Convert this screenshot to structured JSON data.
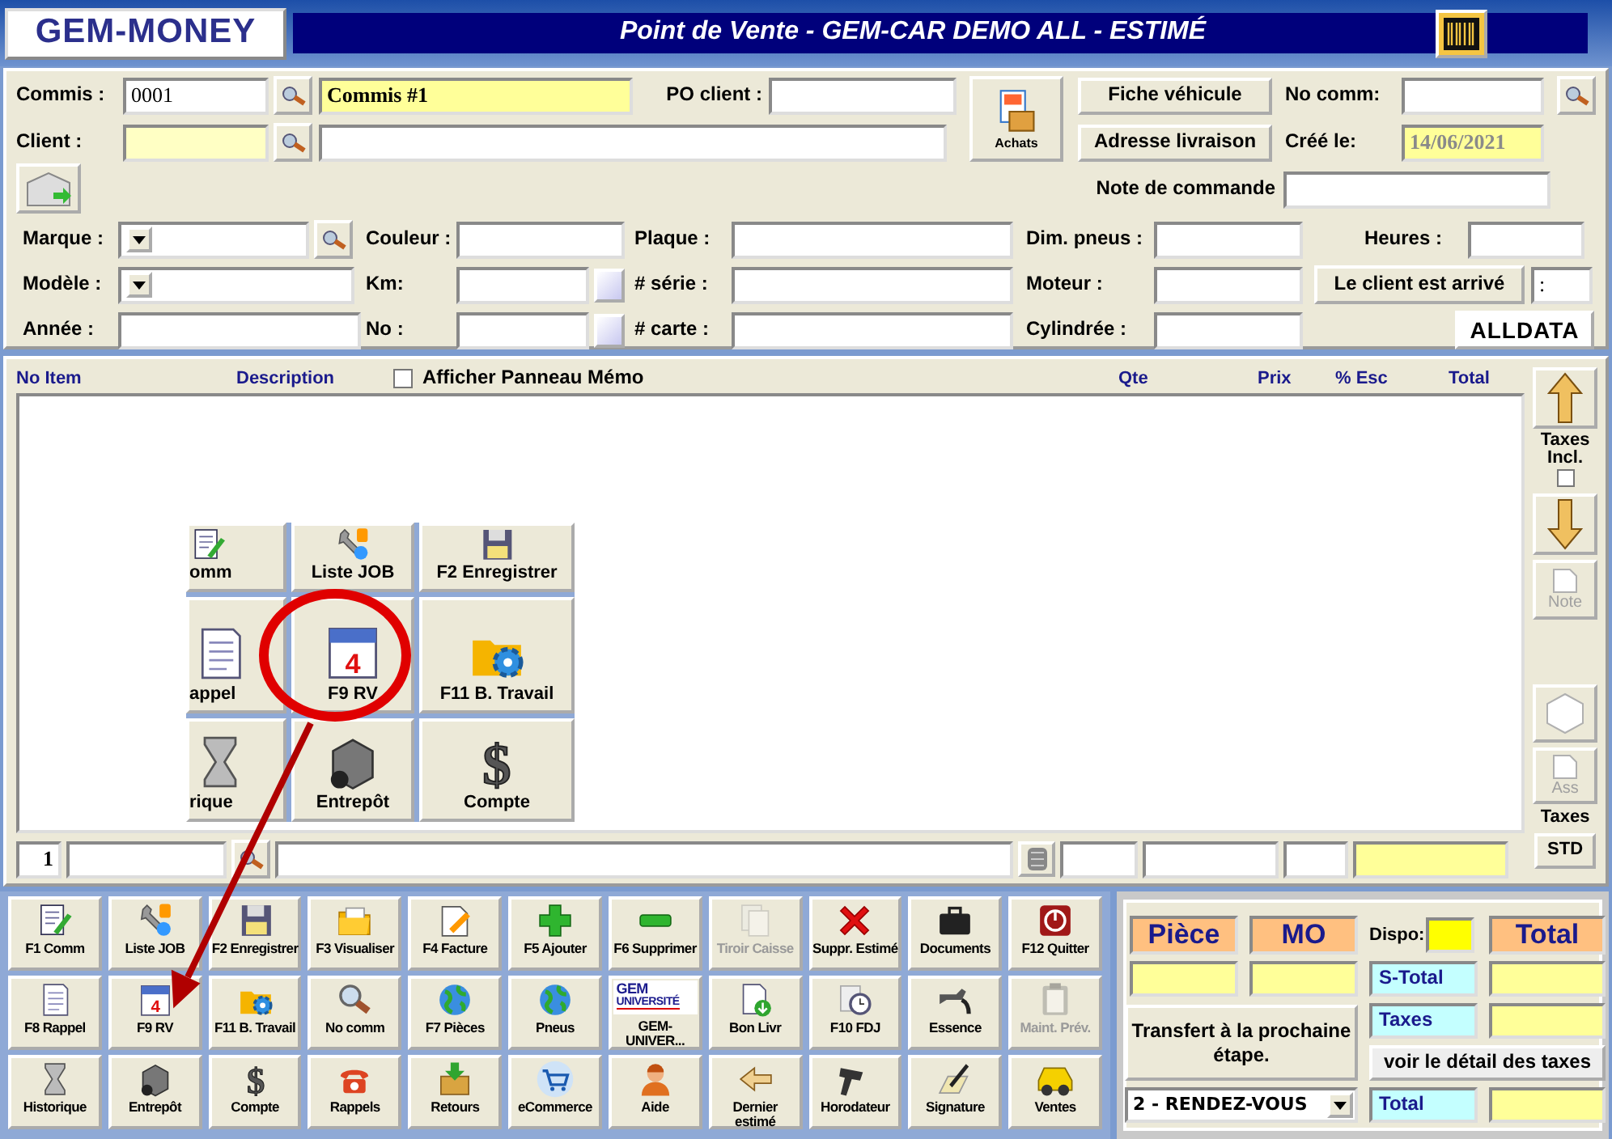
{
  "window": {
    "logo": "GEM-MONEY",
    "title": "Point de Vente - GEM-CAR DEMO ALL  - ESTIMÉ"
  },
  "order": {
    "commis_label": "Commis :",
    "commis_value": "0001",
    "commis_name": "Commis #1",
    "client_label": "Client :",
    "po_label": "PO client :",
    "achats": "Achats",
    "fiche_button": "Fiche véhicule",
    "adresse_button": "Adresse livraison",
    "no_comm_label": "No comm:",
    "cree_label": "Créé le:",
    "cree_value": "14/06/2021",
    "note_label": "Note de commande"
  },
  "vehicle": {
    "rows": [
      [
        {
          "label": "Marque :",
          "kind": "combo_lookup"
        },
        {
          "label": "Couleur :",
          "kind": "text"
        },
        {
          "label": "Plaque :",
          "kind": "text"
        },
        {
          "label": "Dim. pneus :",
          "kind": "text"
        }
      ],
      [
        {
          "label": "Modèle :",
          "kind": "combo"
        },
        {
          "label": "Km:",
          "kind": "picker"
        },
        {
          "label": "# série :",
          "kind": "text"
        },
        {
          "label": "Moteur :",
          "kind": "text"
        }
      ],
      [
        {
          "label": "Année :",
          "kind": "text"
        },
        {
          "label": "No :",
          "kind": "picker"
        },
        {
          "label": "# carte :",
          "kind": "text"
        },
        {
          "label": "Cylindrée :",
          "kind": "text"
        }
      ]
    ],
    "heures_label": "Heures :",
    "arrived_button": "Le client est arrivé",
    "arrived_value": ":",
    "alldata_logo": "ALLDATA"
  },
  "table": {
    "columns": [
      "No Item",
      "Description",
      "Qte",
      "Prix",
      "% Esc",
      "Total"
    ],
    "memo_checkbox": {
      "label": "Afficher Panneau Mémo",
      "checked": false
    },
    "line_number": "1"
  },
  "side": {
    "taxes_incl": {
      "label": "Taxes Incl.",
      "checked": false
    },
    "note": {
      "label": "Note",
      "disabled": true
    },
    "symbol": {
      "disabled": true
    },
    "ass": {
      "label": "Ass",
      "disabled": true
    },
    "taxes_label": "Taxes",
    "std_button": "STD"
  },
  "inset": {
    "cells": [
      {
        "label": "omm"
      },
      {
        "label": "Liste JOB"
      },
      {
        "label": "F2 Enregistrer"
      },
      {
        "label": "appel"
      },
      {
        "label": "F9 RV",
        "glyph": "4"
      },
      {
        "label": "F11 B. Travail"
      },
      {
        "label": "rique"
      },
      {
        "label": "Entrepôt"
      },
      {
        "label": "Compte",
        "glyph": "$"
      }
    ]
  },
  "bottom_buttons": [
    [
      {
        "label": "F1 Comm",
        "disabled": false,
        "kind": "icon"
      },
      {
        "label": "Liste JOB",
        "disabled": false,
        "kind": "icon"
      },
      {
        "label": "F2 Enregistrer",
        "disabled": false,
        "kind": "icon"
      },
      {
        "label": "F3 Visualiser",
        "disabled": false,
        "kind": "icon"
      },
      {
        "label": "F4  Facture",
        "disabled": false,
        "kind": "icon"
      },
      {
        "label": "F5  Ajouter",
        "disabled": false,
        "kind": "icon"
      },
      {
        "label": "F6 Supprimer",
        "disabled": false,
        "kind": "icon"
      },
      {
        "label": "Tiroir Caisse",
        "disabled": true,
        "kind": "icon"
      },
      {
        "label": "Suppr. Estimé",
        "disabled": false,
        "kind": "icon"
      },
      {
        "label": "Documents",
        "disabled": false,
        "kind": "icon"
      },
      {
        "label": "F12 Quitter",
        "disabled": false,
        "kind": "icon"
      }
    ],
    [
      {
        "label": "F8 Rappel",
        "disabled": false,
        "kind": "icon"
      },
      {
        "label": "F9 RV",
        "disabled": false,
        "kind": "icon",
        "glyph": "4"
      },
      {
        "label": "F11 B. Travail",
        "disabled": false,
        "kind": "icon"
      },
      {
        "label": "No comm",
        "disabled": false,
        "kind": "icon"
      },
      {
        "label": "F7  Pièces",
        "disabled": false,
        "kind": "icon"
      },
      {
        "label": "Pneus",
        "disabled": false,
        "kind": "icon"
      },
      {
        "label": "GEM-UNIVER...",
        "disabled": false,
        "kind": "logo",
        "logo_lines": [
          "GEM",
          "UNIVERSITÉ"
        ]
      },
      {
        "label": "Bon Livr",
        "disabled": false,
        "kind": "icon"
      },
      {
        "label": "F10  FDJ",
        "disabled": false,
        "kind": "icon"
      },
      {
        "label": "Essence",
        "disabled": false,
        "kind": "icon"
      },
      {
        "label": "Maint. Prév.",
        "disabled": true,
        "kind": "icon"
      }
    ],
    [
      {
        "label": "Historique",
        "disabled": false,
        "kind": "icon"
      },
      {
        "label": "Entrepôt",
        "disabled": false,
        "kind": "icon"
      },
      {
        "label": "Compte",
        "disabled": false,
        "kind": "icon",
        "glyph": "$"
      },
      {
        "label": "Rappels",
        "disabled": false,
        "kind": "icon"
      },
      {
        "label": "Retours",
        "disabled": false,
        "kind": "icon"
      },
      {
        "label": "eCommerce",
        "disabled": false,
        "kind": "icon"
      },
      {
        "label": "Aide",
        "disabled": false,
        "kind": "icon"
      },
      {
        "label": "Dernier estimé",
        "disabled": false,
        "kind": "icon"
      },
      {
        "label": "Horodateur",
        "disabled": false,
        "kind": "icon"
      },
      {
        "label": "Signature",
        "disabled": false,
        "kind": "icon"
      },
      {
        "label": "Ventes",
        "disabled": false,
        "kind": "icon"
      }
    ]
  ],
  "totals": {
    "piece_header": "Pièce",
    "mo_header": "MO",
    "dispo_label": "Dispo:",
    "total_header": "Total",
    "stotal_label": "S-Total",
    "taxes_label": "Taxes",
    "transfer_button": "Transfert à la prochaine étape.",
    "tax_detail_button": "voir le détail des taxes",
    "stage_value": "2 - RENDEZ-VOUS",
    "total_label": "Total"
  }
}
